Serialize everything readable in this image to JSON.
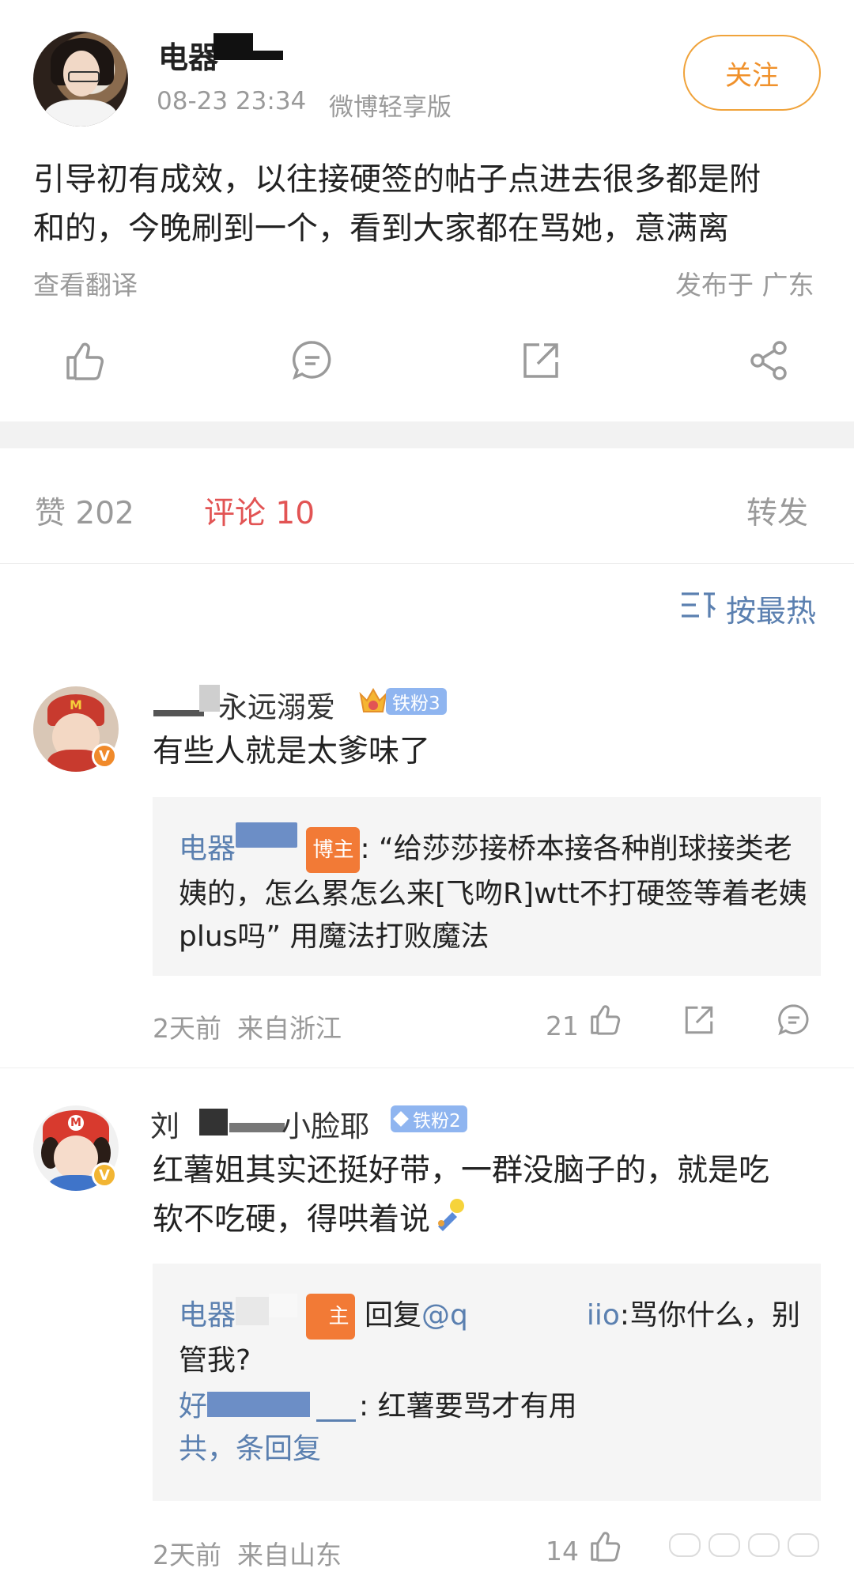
{
  "post": {
    "author_name_visible": "电器",
    "timestamp": "08-23 23:34",
    "source": "微博轻享版",
    "follow_label": "关注",
    "body_line1": "引导初有成效，以往接硬签的帖子点进去很多都是附",
    "body_line2": "和的，今晚刷到一个，看到大家都在骂她，意满离",
    "translate_label": "查看翻译",
    "location": "发布于 广东"
  },
  "action_icons": [
    "thumbs-up-icon",
    "comment-icon",
    "repost-icon",
    "share-icon"
  ],
  "tabs": {
    "likes": "赞 202",
    "comments": "评论 10",
    "reposts": "转发"
  },
  "sort": {
    "label": "按最热",
    "icon": "sort-icon"
  },
  "comments": [
    {
      "name_visible": "永远溺爱",
      "badge": "铁粉3",
      "text": "有些人就是太爹味了",
      "reply": {
        "name": "电器",
        "tag": "博主",
        "line1": ": “给莎莎接桥本接各种削球接类老",
        "line2": "姨的，怎么累怎么来[飞吻R]wtt不打硬签等着老姨",
        "line3": "plus吗” 用魔法打败魔法"
      },
      "time": "2天前",
      "location": "来自浙江",
      "likes": "21"
    },
    {
      "name_prefix": "刘",
      "name_visible": "小脸耶",
      "badge": "铁粉2",
      "text_line1": "红薯姐其实还挺好带，一群没脑子的，就是吃",
      "text_line2": "软不吃硬，得哄着说",
      "reply": {
        "name": "电器",
        "tag": "主",
        "reply_word": "回复",
        "mention_start": "@q",
        "mention_end": "iio",
        "line1_rest": ":骂你什么，别",
        "line2": "管我?",
        "sub_name": "好",
        "sub_text": ": 红薯要骂才有用",
        "more": "共，条回复"
      },
      "time": "2天前",
      "location": "来自山东",
      "likes": "14"
    }
  ],
  "colors": {
    "accent_orange": "#f0912b",
    "active_tab_red": "#e25454",
    "link_blue": "#5b80b0",
    "badge_blue": "#8fb5f0"
  }
}
